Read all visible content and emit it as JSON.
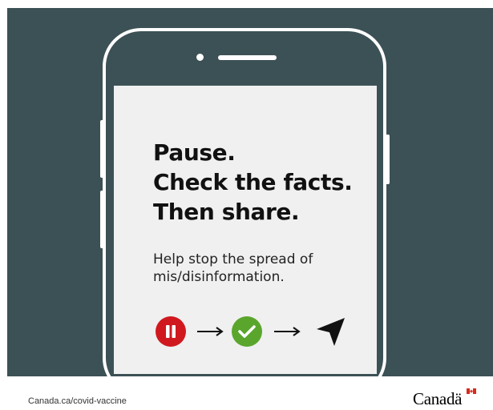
{
  "headline": {
    "line1": "Pause.",
    "line2": "Check the facts.",
    "line3": "Then share."
  },
  "subtext": {
    "line1": "Help stop the spread of",
    "line2": "mis/disinformation."
  },
  "steps": [
    {
      "icon": "pause-icon",
      "color": "#d0191f"
    },
    {
      "icon": "arrow-right-icon",
      "color": "#111111"
    },
    {
      "icon": "check-icon",
      "color": "#5aa62d"
    },
    {
      "icon": "arrow-right-icon",
      "color": "#111111"
    },
    {
      "icon": "send-cursor-icon",
      "color": "#111111"
    }
  ],
  "footer": {
    "url": "Canada.ca/covid-vaccine",
    "wordmark": "Canadä"
  },
  "colors": {
    "background": "#3c5155",
    "screen": "#f0f0f0",
    "pause": "#d0191f",
    "check": "#5aa62d",
    "flag_red": "#d52b1e"
  }
}
